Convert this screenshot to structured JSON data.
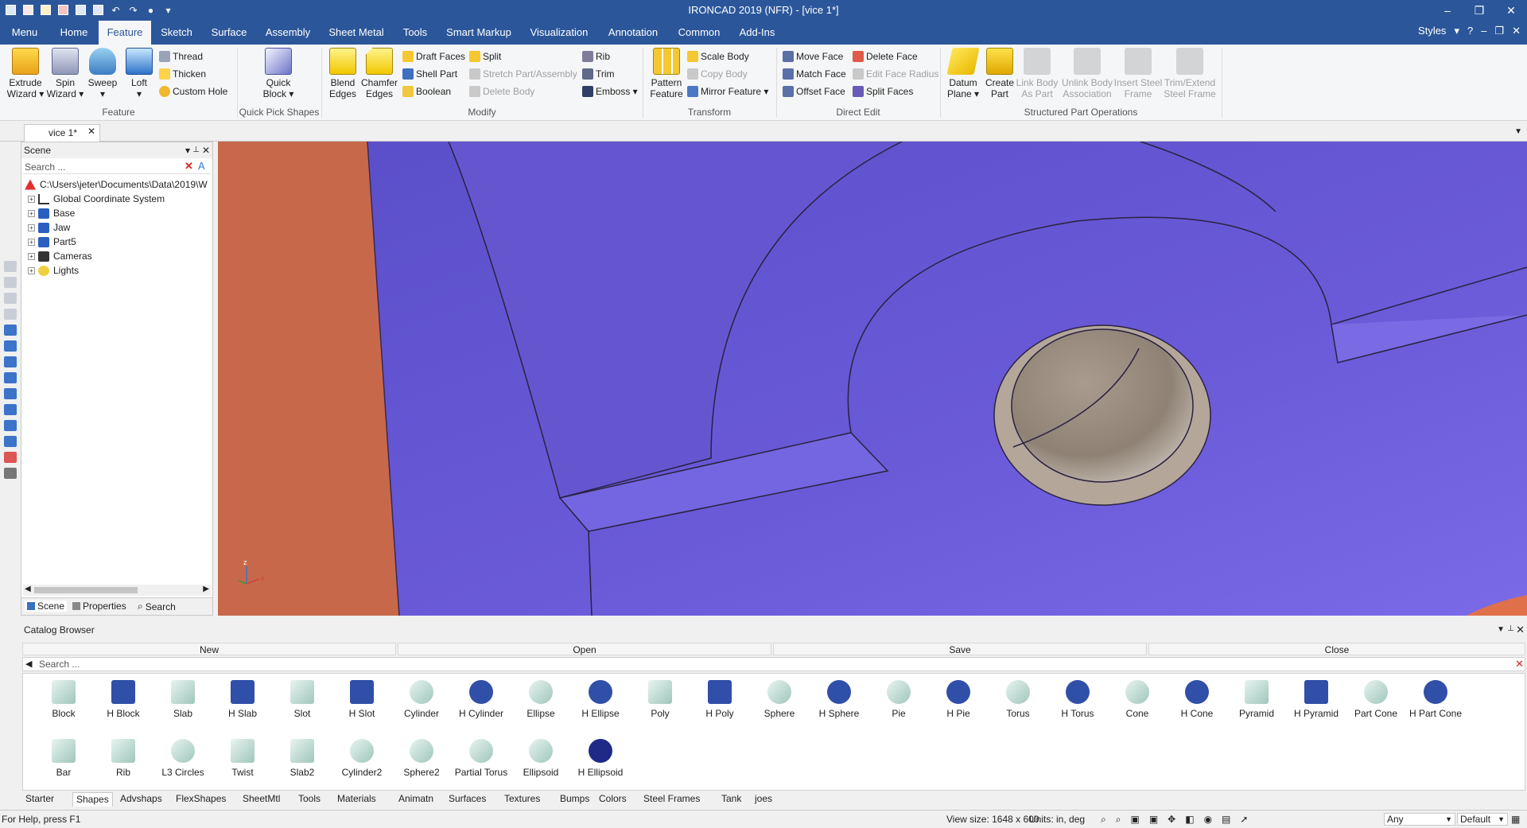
{
  "app": {
    "title": "IRONCAD 2019 (NFR) - [vice 1*]"
  },
  "colors": {
    "accent": "#2b579a",
    "viewport_bg": "#6a5ad8",
    "part_orange": "#c8684a",
    "hole": "#9b8d80"
  },
  "menu_tabs": [
    "Menu",
    "Home",
    "Feature",
    "Sketch",
    "Surface",
    "Assembly",
    "Sheet Metal",
    "Tools",
    "Smart Markup",
    "Visualization",
    "Annotation",
    "Common",
    "Add-Ins"
  ],
  "active_tab": "Feature",
  "styles_label": "Styles",
  "ribbon": {
    "feature": {
      "extrude_wizard": "Extrude\nWizard ▾",
      "spin_wizard": "Spin\nWizard ▾",
      "sweep": "Sweep\n▾",
      "loft": "Loft\n▾",
      "thread": "Thread",
      "thicken": "Thicken",
      "custom_hole": "Custom Hole",
      "label": "Feature"
    },
    "quick_pick": {
      "quick_block": "Quick\nBlock ▾",
      "label": "Quick Pick Shapes"
    },
    "modify": {
      "blend_edges": "Blend\nEdges",
      "chamfer_edges": "Chamfer\nEdges",
      "draft_faces": "Draft Faces",
      "shell_part": "Shell Part",
      "boolean": "Boolean",
      "split": "Split",
      "stretch": "Stretch Part/Assembly",
      "delete_body": "Delete Body",
      "rib": "Rib",
      "trim": "Trim",
      "emboss": "Emboss ▾",
      "label": "Modify"
    },
    "transform": {
      "pattern_feature": "Pattern\nFeature",
      "scale_body": "Scale Body",
      "copy_body": "Copy Body",
      "mirror_feature": "Mirror Feature ▾",
      "label": "Transform"
    },
    "direct_edit": {
      "move_face": "Move Face",
      "match_face": "Match Face",
      "offset_face": "Offset Face",
      "delete_face": "Delete Face",
      "edit_face_radius": "Edit Face Radius",
      "split_faces": "Split Faces",
      "label": "Direct Edit"
    },
    "structured": {
      "datum_plane": "Datum\nPlane ▾",
      "create_part": "Create\nPart",
      "link_body": "Link Body\nAs Part",
      "unlink_body": "Unlink Body\nAssociation",
      "insert_steel": "Insert Steel\nFrame",
      "trim_extend": "Trim/Extend\nSteel Frame",
      "label": "Structured Part Operations"
    }
  },
  "doc_tab": "vice 1*",
  "scene": {
    "title": "Scene",
    "search_placeholder": "Search ...",
    "path": "C:\\Users\\jeter\\Documents\\Data\\2019\\W",
    "items": [
      "Global Coordinate System",
      "Base",
      "Jaw",
      "Part5",
      "Cameras",
      "Lights"
    ],
    "tabs": [
      "Scene",
      "Properties",
      "Search"
    ]
  },
  "triad": {
    "z": "z",
    "x": "x"
  },
  "catalog": {
    "title": "Catalog Browser",
    "buttons": [
      "New",
      "Open",
      "Save",
      "Close"
    ],
    "search_placeholder": "Search ...",
    "shapes_row1": [
      "Block",
      "H Block",
      "Slab",
      "H Slab",
      "Slot",
      "H Slot",
      "Cylinder",
      "H Cylinder",
      "Ellipse",
      "H Ellipse",
      "Poly",
      "H Poly",
      "Sphere",
      "H Sphere",
      "Pie",
      "H Pie",
      "Torus",
      "H Torus",
      "Cone",
      "H Cone",
      "Pyramid",
      "H Pyramid",
      "Part Cone",
      "H Part Cone"
    ],
    "shapes_row2": [
      "Bar",
      "Rib",
      "L3 Circles",
      "Twist",
      "Slab2",
      "Cylinder2",
      "Sphere2",
      "Partial Torus",
      "Ellipsoid",
      "H Ellipsoid"
    ],
    "tabs": [
      "Starter",
      "Shapes",
      "Advshaps",
      "FlexShapes",
      "SheetMtl",
      "Tools",
      "Materials",
      "Animatn",
      "Surfaces",
      "Textures",
      "Bumps",
      "Colors",
      "Steel Frames",
      "Tank",
      "joes"
    ],
    "active_tab": "Shapes"
  },
  "status": {
    "help": "For Help, press F1",
    "view_size": "View size: 1648 x 600",
    "units": "Units: in, deg",
    "filter": "Any",
    "style": "Default"
  }
}
